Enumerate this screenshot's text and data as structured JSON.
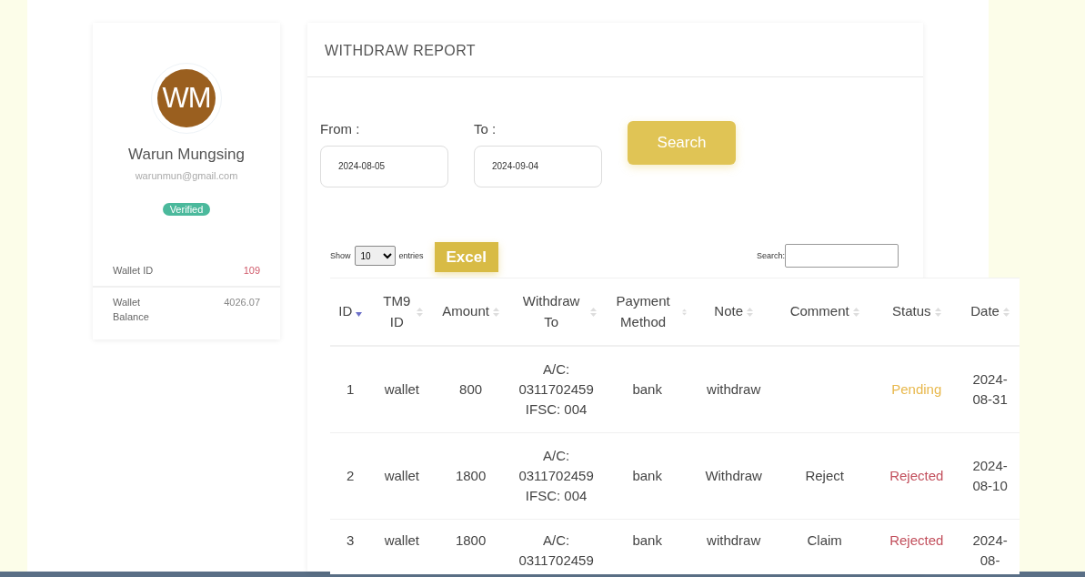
{
  "profile": {
    "initials": "WM",
    "name": "Warun Mungsing",
    "email": "warunmun@gmail.com",
    "badge": "Verified",
    "fields": [
      {
        "label": "Wallet ID",
        "value": "109",
        "kind": "accent"
      },
      {
        "label": "Wallet Balance",
        "value": "4026.07",
        "kind": "plain"
      }
    ]
  },
  "report": {
    "title": "WITHDRAW REPORT",
    "filters": [
      {
        "label": "From :",
        "value": "2024-08-05"
      },
      {
        "label": "To :",
        "value": "2024-09-04"
      }
    ],
    "search_button": "Search",
    "length": {
      "show": "Show",
      "value": "10",
      "entries": "entries"
    },
    "excel_button": "Excel",
    "table_search_label": "Search:",
    "table": {
      "columns": [
        {
          "label": "ID",
          "sorted": true
        },
        {
          "label": "TM9 ID",
          "sorted": false
        },
        {
          "label": "Amount",
          "sorted": false
        },
        {
          "label": "Withdraw To",
          "sorted": false
        },
        {
          "label": "Payment Method",
          "sorted": false
        },
        {
          "label": "Note",
          "sorted": false
        },
        {
          "label": "Comment",
          "sorted": false
        },
        {
          "label": "Status",
          "sorted": false
        },
        {
          "label": "Date",
          "sorted": false
        }
      ],
      "rows": [
        {
          "cells": [
            "1",
            "wallet",
            "800",
            "A/C: 0311702459 IFSC: 004",
            "bank",
            "withdraw",
            ""
          ],
          "status": "Pending",
          "color": "#e8b84c",
          "date": "2024-08-31"
        },
        {
          "cells": [
            "2",
            "wallet",
            "1800",
            "A/C: 0311702459 IFSC: 004",
            "bank",
            "Withdraw",
            "Reject"
          ],
          "status": "Rejected",
          "color": "#c24f5c",
          "date": "2024-08-10"
        },
        {
          "cells": [
            "3",
            "wallet",
            "1800",
            "A/C: 0311702459",
            "bank",
            "withdraw",
            "Claim"
          ],
          "status": "Rejected",
          "color": "#c24f5c",
          "date": "2024-08-"
        }
      ]
    }
  }
}
